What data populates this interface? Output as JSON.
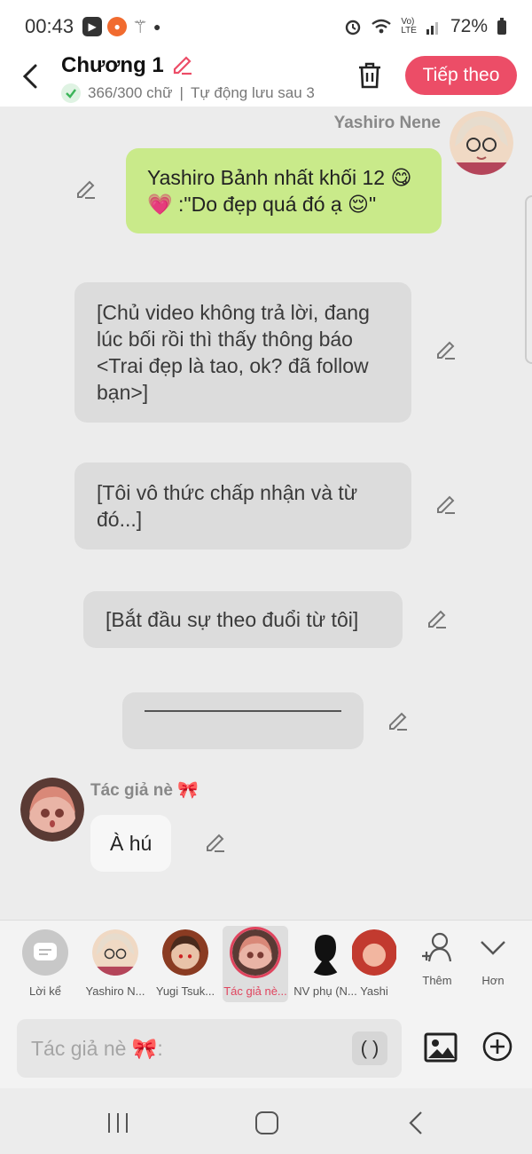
{
  "status_bar": {
    "time": "00:43",
    "battery": "72%",
    "network_label_top": "Vo)",
    "network_label_bottom": "LTE",
    "icons": [
      "media-icon",
      "recorder-icon",
      "magic-wand-icon",
      "dot-icon",
      "alarm-icon",
      "wifi-icon",
      "signal-icon",
      "battery-icon"
    ]
  },
  "header": {
    "title": "Chương 1",
    "word_count": "366/300 chữ",
    "separator": "|",
    "autosave": "Tự động lưu sau 3",
    "next_label": "Tiếp theo"
  },
  "messages": [
    {
      "sender": "Yashiro Nene",
      "text": "Yashiro Bảnh nhất khối 12 😋💗 :\"Do đẹp quá đó ạ 😌\""
    },
    {
      "text": "[Chủ video không trả lời, đang lúc bối rồi thì thấy thông báo <Trai đẹp là tao, ok? đã follow bạn>]"
    },
    {
      "text": "[Tôi vô thức chấp nhận và từ đó...]"
    },
    {
      "text": "[Bắt đầu sự theo đuổi từ tôi]"
    },
    {
      "text": ""
    },
    {
      "sender": "Tác giả nè 🎀",
      "text": "À hú"
    }
  ],
  "characters": [
    {
      "label": "Lời kể"
    },
    {
      "label": "Yashiro N..."
    },
    {
      "label": "Yugi Tsuk..."
    },
    {
      "label": "Tác giả nè..."
    },
    {
      "label": "NV phụ (N..."
    },
    {
      "label": "Yashi"
    }
  ],
  "char_actions": {
    "add_label": "Thêm",
    "more_label": "Hơn"
  },
  "composer": {
    "placeholder": "Tác giả nè 🎀:",
    "paren_label": "( )"
  },
  "colors": {
    "accent": "#ec4d67",
    "green_bubble": "#c9ea8a",
    "grey_bubble": "#dcdcdc",
    "background": "#ececec"
  }
}
